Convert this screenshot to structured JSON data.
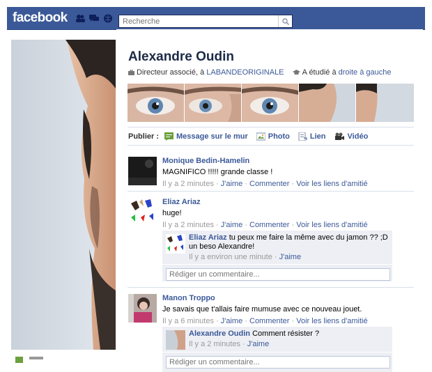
{
  "topbar": {
    "logo": "facebook",
    "search_placeholder": "Recherche"
  },
  "profile": {
    "name": "Alexandre Oudin",
    "work_prefix": "Directeur associé, à ",
    "work_link": "LABANDEORIGINALE",
    "study_prefix": "A étudié à ",
    "study_link": "droite à gauche"
  },
  "publish": {
    "label": "Publier :",
    "items": [
      {
        "label": "Message sur le mur",
        "icon": "wall-post-icon"
      },
      {
        "label": "Photo",
        "icon": "photo-icon"
      },
      {
        "label": "Lien",
        "icon": "link-icon"
      },
      {
        "label": "Vidéo",
        "icon": "video-icon"
      }
    ]
  },
  "stories": [
    {
      "author": "Monique Bedin-Hamelin",
      "text": "MAGNIFICO !!!!! grande classe !",
      "time": "Il y a 2 minutes",
      "like": "J'aime",
      "comment": "Commenter",
      "friendship": "Voir les liens d'amitié"
    },
    {
      "author": "Eliaz Ariaz",
      "text": "huge!",
      "time": "Il y a 2 minutes",
      "like": "J'aime",
      "comment": "Commenter",
      "friendship": "Voir les liens d'amitié",
      "reply": {
        "author": "Eliaz Ariaz",
        "text": "tu peux me faire la même avec du jamon ?? ;D un beso Alexandre!",
        "time": "Il y a environ une minute",
        "like": "J'aime"
      },
      "input_placeholder": "Rédiger un commentaire..."
    },
    {
      "author": "Manon Troppo",
      "text": "Je savais que t'allais faire mumuse avec ce nouveau jouet.",
      "time": "Il y a 6 minutes",
      "like": "J'aime",
      "comment": "Commenter",
      "friendship": "Voir les liens d'amitié",
      "reply": {
        "author": "Alexandre Oudin",
        "text": "Comment résister ?",
        "time": "Il y a 2 minutes",
        "like": "J'aime"
      },
      "input_placeholder": "Rédiger un commentaire..."
    }
  ],
  "separators": {
    "dot": " · "
  },
  "colors": {
    "brand": "#3b5998",
    "comment_bg": "#edeff4"
  }
}
